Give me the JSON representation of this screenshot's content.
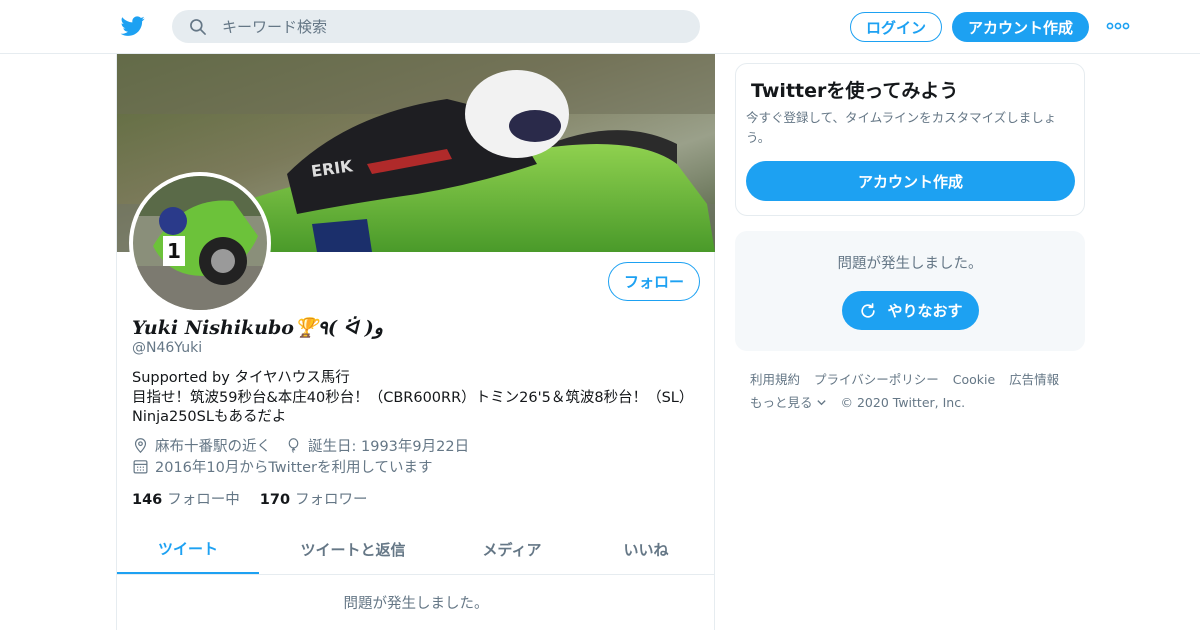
{
  "colors": {
    "accent": "#1da1f2",
    "secondary_text": "#657786",
    "primary_text": "#14171a",
    "border": "#e6ecf0"
  },
  "header": {
    "logo_icon": "twitter-bird-icon",
    "search": {
      "placeholder": "キーワード検索",
      "icon": "search-icon"
    },
    "login_label": "ログイン",
    "signup_label": "アカウント作成",
    "more_icon": "more-dots-icon"
  },
  "profile": {
    "banner_image": "motorcycle-racer-banner",
    "avatar_image": "green-motorcycle-avatar",
    "follow_label": "フォロー",
    "name": "Yuki Nishikubo🏆٩( ᐛ )و",
    "handle": "@N46Yuki",
    "bio": [
      "Supported by タイヤハウス馬行",
      "目指せ！筑波59秒台&本庄40秒台！（CBR600RR）トミン26'5＆筑波8秒台！（SL）",
      "Ninja250SLもあるだよ"
    ],
    "location": "麻布十番駅の近く",
    "birthday": "誕生日: 1993年9月22日",
    "joined": "2016年10月からTwitterを利用しています",
    "following_count": "146",
    "following_label": "フォロー中",
    "followers_count": "170",
    "followers_label": "フォロワー"
  },
  "tabs": [
    {
      "label": "ツイート",
      "active": true
    },
    {
      "label": "ツイートと返信",
      "active": false
    },
    {
      "label": "メディア",
      "active": false
    },
    {
      "label": "いいね",
      "active": false
    }
  ],
  "timeline": {
    "error": "問題が発生しました。"
  },
  "sidebar": {
    "signup_card": {
      "title": "Twitterを使ってみよう",
      "description": "今すぐ登録して、タイムラインをカスタマイズしましょう。",
      "button": "アカウント作成"
    },
    "error_card": {
      "message": "問題が発生しました。",
      "retry": "やりなおす"
    },
    "footer": {
      "links": [
        "利用規約",
        "プライバシーポリシー",
        "Cookie",
        "広告情報"
      ],
      "more": "もっと見る",
      "copyright": "© 2020 Twitter, Inc."
    }
  }
}
